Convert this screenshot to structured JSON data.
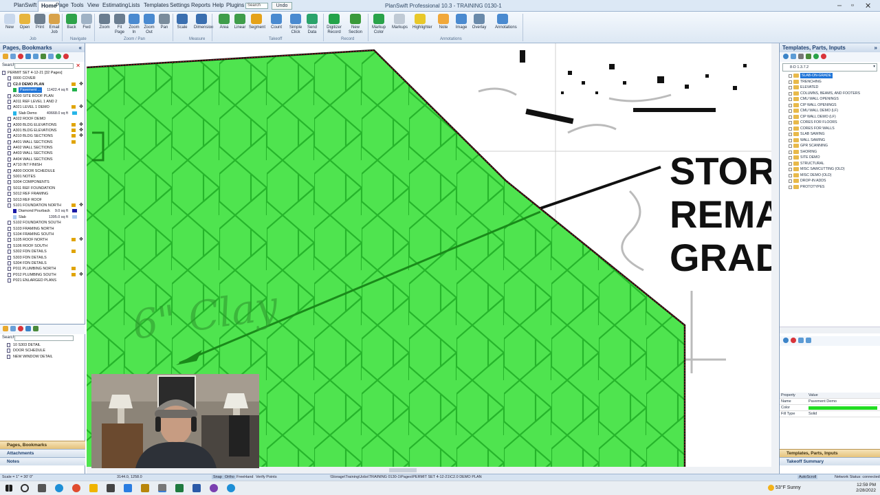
{
  "app": {
    "title": "PlanSwift Professional 10.3 - TRAINING 0130-1",
    "search_placeholder": "Search",
    "undo_label": "Undo"
  },
  "menu": [
    "PlanSwift",
    "Home",
    "Page",
    "Tools",
    "View",
    "Estimating",
    "Lists",
    "Templates",
    "Settings",
    "Reports",
    "Help",
    "Plugins"
  ],
  "ribbon": {
    "buttons": [
      {
        "label": "New"
      },
      {
        "label": "Open"
      },
      {
        "label": "Print"
      },
      {
        "label": "Email\nJob"
      },
      {
        "label": "Back"
      },
      {
        "label": "Fwd"
      },
      {
        "label": "Zoom"
      },
      {
        "label": "Fit\nPage"
      },
      {
        "label": "Zoom\nIn"
      },
      {
        "label": "Zoom\nOut"
      },
      {
        "label": "Pan"
      },
      {
        "label": "Scale"
      },
      {
        "label": "Dimension"
      },
      {
        "label": "Area"
      },
      {
        "label": "Linear"
      },
      {
        "label": "Segment"
      },
      {
        "label": "Count"
      },
      {
        "label": "Simple\nClick"
      },
      {
        "label": "Send\nData"
      },
      {
        "label": "Digitizer\nRecord"
      },
      {
        "label": "New\nSection"
      },
      {
        "label": "Markup\nColor"
      },
      {
        "label": "Markups"
      },
      {
        "label": "Highlighter"
      },
      {
        "label": "Note"
      },
      {
        "label": "Image"
      },
      {
        "label": "Overlay"
      },
      {
        "label": "Annotations"
      }
    ],
    "groups": [
      "Job",
      "Navigate",
      "Zoom / Pan",
      "Measure",
      "Takeoff",
      "Record",
      "Annotations"
    ]
  },
  "left_panel": {
    "title": "Pages, Bookmarks",
    "search_label": "Search:",
    "pages": [
      {
        "name": "PERMIT SET 4-12-21 [32 Pages]",
        "indent": 0
      },
      {
        "name": "0000 COVER",
        "indent": 1
      },
      {
        "name": "C2.0 DEMO PLAN",
        "indent": 1,
        "bold": true
      },
      {
        "name": "Pavement ...",
        "indent": 2,
        "selected": true,
        "qty": "11422.4 sq ft",
        "color": "#22b14c"
      },
      {
        "name": "A000 SITE ROOF PLAN",
        "indent": 1
      },
      {
        "name": "A011 REF LEVEL 1 AND 2",
        "indent": 1
      },
      {
        "name": "A021 LEVEL 1 DEMO",
        "indent": 1
      },
      {
        "name": "Slab Demo",
        "indent": 2,
        "qty": "40668.0 sq ft",
        "color": "#27b5e8"
      },
      {
        "name": "A022 ROOF DEMO",
        "indent": 1
      },
      {
        "name": "A300 BLDG ELEVATIONS",
        "indent": 1
      },
      {
        "name": "A301 BLDG ELEVATIONS",
        "indent": 1
      },
      {
        "name": "A310 BLDG SECTIONS",
        "indent": 1
      },
      {
        "name": "A401 WALL SECTIONS",
        "indent": 1
      },
      {
        "name": "A402 WALL SECTIONS",
        "indent": 1
      },
      {
        "name": "A403 WALL SECTIONS",
        "indent": 1
      },
      {
        "name": "A404 WALL SECTIONS",
        "indent": 1
      },
      {
        "name": "A710 INT FINISH",
        "indent": 1
      },
      {
        "name": "A800 DOOR SCHEDULE",
        "indent": 1
      },
      {
        "name": "S001 NOTES",
        "indent": 1
      },
      {
        "name": "S004 COMPONENTS",
        "indent": 1
      },
      {
        "name": "S011 REF FOUNDATION",
        "indent": 1
      },
      {
        "name": "S012 REF FRAMING",
        "indent": 1
      },
      {
        "name": "S013 REF ROOF",
        "indent": 1
      },
      {
        "name": "S101 FOUNDATION NORTH",
        "indent": 1
      },
      {
        "name": "Diamond Pourback",
        "indent": 2,
        "qty": "9.0 sq ft",
        "color": "#1a1aa6"
      },
      {
        "name": "Slab",
        "indent": 2,
        "qty": "1395.0 sq ft",
        "color": "#aac8ee"
      },
      {
        "name": "S102 FOUNDATION SOUTH",
        "indent": 1
      },
      {
        "name": "S103 FRAMING NORTH",
        "indent": 1
      },
      {
        "name": "S104 FRAMING SOUTH",
        "indent": 1
      },
      {
        "name": "S105 ROOF NORTH",
        "indent": 1
      },
      {
        "name": "S106 ROOF SOUTH",
        "indent": 1
      },
      {
        "name": "S302 FDN DETAILS",
        "indent": 1
      },
      {
        "name": "S303 FDN DETAILS",
        "indent": 1
      },
      {
        "name": "S304 FDN DETAILS",
        "indent": 1
      },
      {
        "name": "P011 PLUMBING NORTH",
        "indent": 1
      },
      {
        "name": "P012 PLUMBING SOUTH",
        "indent": 1
      },
      {
        "name": "P021 ENLARGED PLANS",
        "indent": 1
      }
    ],
    "bookmarks_search_label": "Search:",
    "bookmarks": [
      "10 S303 DETAIL",
      "DOOR SCHEDULE",
      "NEW WINDOW DETAIL"
    ],
    "accordion": [
      "Pages, Bookmarks",
      "Attachments",
      "Notes"
    ]
  },
  "canvas": {
    "drawing_text": [
      "STOR",
      "REMA",
      "GRAD"
    ],
    "handwriting": "6\" Clay"
  },
  "right_panel": {
    "title": "Templates, Parts, Inputs",
    "dropdown": "8-D 1.3.7.2",
    "items": [
      "SLAB-ON-GRADE",
      "TRENCHING",
      "ELEVATED",
      "COLUMNS, BEAMS, AND FOOTERS",
      "CMU WALL OPENINGS",
      "CIP WALL OPENINGS",
      "CMU WALL DEMO (LF)",
      "CIP WALL DEMO (LF)",
      "CORES FOR FLOORS",
      "CORES FOR WALLS",
      "SLAB SAWING",
      "WALL SAWING",
      "GPR SCANNING",
      "SHORING",
      "SITE DEMO",
      "STRUCTURAL",
      "MISC SAWCUTTING (OLD)",
      "MISC DEMO (OLD)",
      "DROP-IN ADDS",
      "PROTOTYPES"
    ],
    "properties_header": {
      "property": "Property",
      "value": "Value"
    },
    "properties": [
      {
        "key": "Name",
        "value": "Pavement Demo"
      },
      {
        "key": "Color",
        "value": "",
        "color": "#22dd22"
      },
      {
        "key": "Fill Type",
        "value": "Solid"
      }
    ],
    "accordion": [
      "Templates, Parts, Inputs",
      "Takeoff Summary"
    ]
  },
  "status": {
    "scale": "Scale = 1\" = 30' 0\"",
    "coords": "3144.0, 1258.0",
    "snap": "Snap",
    "ortho": "Ortho",
    "freehand": "FreeHand",
    "verify": "Verify Points",
    "path": "\\Storage\\Training\\Jobs\\TRAINING 0130-1\\Pages\\PERMIT SET 4-12-21\\C2.0 DEMO PLAN",
    "autoscroll": "AutoScroll",
    "network": "Network Status: connected"
  },
  "taskbar": {
    "weather": "53°F  Sunny",
    "time": "12:59 PM",
    "date": "2/28/2022"
  }
}
